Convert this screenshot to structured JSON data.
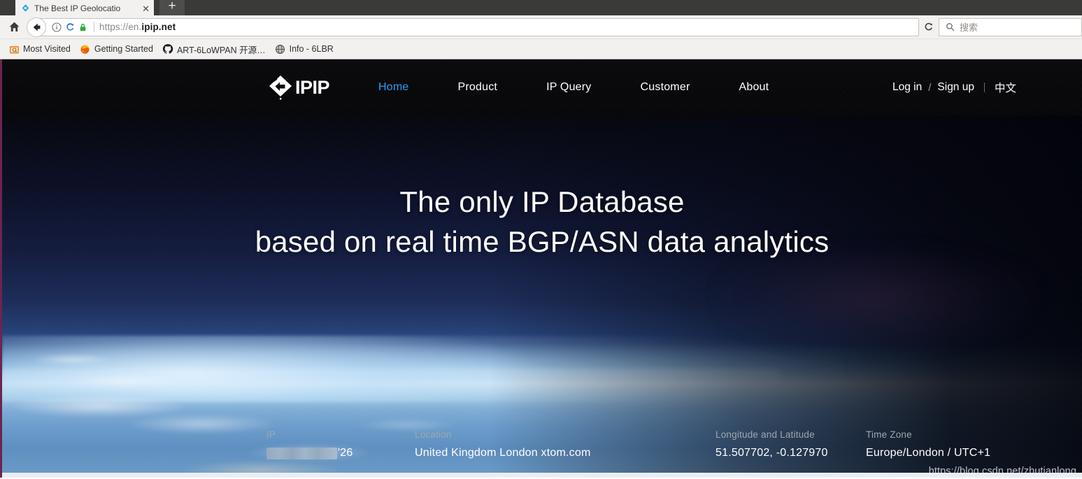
{
  "browser": {
    "tab": {
      "title": "The Best IP Geolocatio",
      "close_label": "✕",
      "favicon": "ipip-favicon-icon"
    },
    "new_tab_label": "+",
    "toolbar": {
      "home_icon": "home-icon",
      "back_icon": "back-arrow-icon",
      "info_icon": "page-info-icon",
      "tracking_icon": "tracking-protection-icon",
      "lock_icon": "padlock-secure-icon",
      "url_prefix": "https://en.",
      "url_domain": "ipip.net",
      "reload_icon": "reload-icon"
    },
    "search": {
      "placeholder": "搜索",
      "icon": "search-icon"
    },
    "bookmarks": [
      {
        "label": "Most Visited",
        "icon": "most-visited-folder-icon"
      },
      {
        "label": "Getting Started",
        "icon": "firefox-logo-icon"
      },
      {
        "label": "ART-6LoWPAN 开源…",
        "icon": "github-logo-icon"
      },
      {
        "label": "Info - 6LBR",
        "icon": "globe-icon"
      }
    ]
  },
  "site": {
    "logo_text": "IPIP",
    "logo_icon": "ipip-diamond-logo-icon",
    "nav": [
      {
        "label": "Home",
        "active": true
      },
      {
        "label": "Product",
        "active": false
      },
      {
        "label": "IP Query",
        "active": false
      },
      {
        "label": "Customer",
        "active": false
      },
      {
        "label": "About",
        "active": false
      }
    ],
    "account": {
      "login": "Log in",
      "separator": "/",
      "signup": "Sign up",
      "language": "中文"
    },
    "hero": {
      "headline_line1": "The only IP Database",
      "headline_line2": "based on real time BGP/ASN data analytics"
    },
    "info": {
      "ip": {
        "label": "IP",
        "value_masked": true,
        "value_tail": "'26"
      },
      "location": {
        "label": "Location",
        "value": "United Kingdom London xtom.com"
      },
      "coordinates": {
        "label": "Longitude and Latitude",
        "value": "51.507702, -0.127970"
      },
      "timezone": {
        "label": "Time Zone",
        "value": "Europe/London / UTC+1"
      }
    }
  },
  "watermark": "https://blog.csdn.net/zhutianlong",
  "colors": {
    "nav_active": "#2e9bf0",
    "header_bg": "#07070a",
    "chrome_bg": "#f2f1f0",
    "left_border": "#6b2550",
    "lock_green": "#37a93c"
  }
}
